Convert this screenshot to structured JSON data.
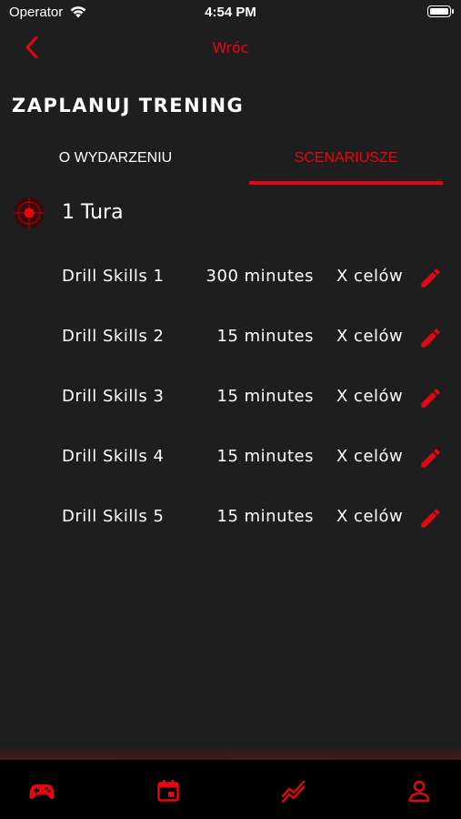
{
  "status_bar": {
    "carrier": "Operator",
    "time": "4:54 PM"
  },
  "nav": {
    "back_label": "Wróc"
  },
  "page": {
    "title": "ZAPLANUJ TRENING"
  },
  "tabs": [
    {
      "label": "O WYDARZENIU",
      "active": false
    },
    {
      "label": "SCENARIUSZE",
      "active": true
    }
  ],
  "round": {
    "title": "1 Tura"
  },
  "drills": [
    {
      "name": "Drill Skills 1",
      "duration": "300 minutes",
      "targets": "X celów"
    },
    {
      "name": "Drill Skills 2",
      "duration": "15 minutes",
      "targets": "X celów"
    },
    {
      "name": "Drill Skills 3",
      "duration": "15 minutes",
      "targets": "X celów"
    },
    {
      "name": "Drill Skills 4",
      "duration": "15 minutes",
      "targets": "X celów"
    },
    {
      "name": "Drill Skills 5",
      "duration": "15 minutes",
      "targets": "X celów"
    }
  ],
  "bottom_nav": [
    {
      "icon": "gamepad-icon"
    },
    {
      "icon": "calendar-icon"
    },
    {
      "icon": "chart-trend-icon"
    },
    {
      "icon": "profile-icon"
    }
  ],
  "colors": {
    "accent": "#e30613",
    "background": "#1e1e1e",
    "tabbar": "#000000"
  }
}
